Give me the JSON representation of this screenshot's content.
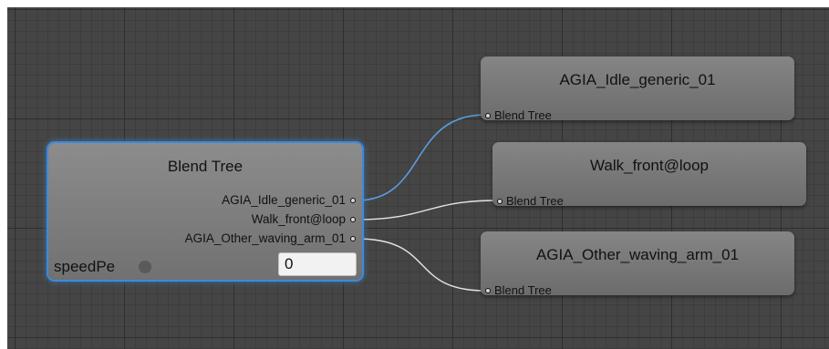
{
  "blend_tree_node": {
    "title": "Blend Tree",
    "outputs": [
      "AGIA_Idle_generic_01",
      "Walk_front@loop",
      "AGIA_Other_waving_arm_01"
    ],
    "parameter_label": "speedPe",
    "parameter_value": "0"
  },
  "motion_nodes": [
    {
      "title": "AGIA_Idle_generic_01",
      "input_label": "Blend Tree"
    },
    {
      "title": "Walk_front@loop",
      "input_label": "Blend Tree"
    },
    {
      "title": "AGIA_Other_waving_arm_01",
      "input_label": "Blend Tree"
    }
  ],
  "colors": {
    "canvas": "#454545",
    "selection": "#3e8ad9",
    "wire_selected": "#5b9de0",
    "wire": "#e6e6e6"
  }
}
